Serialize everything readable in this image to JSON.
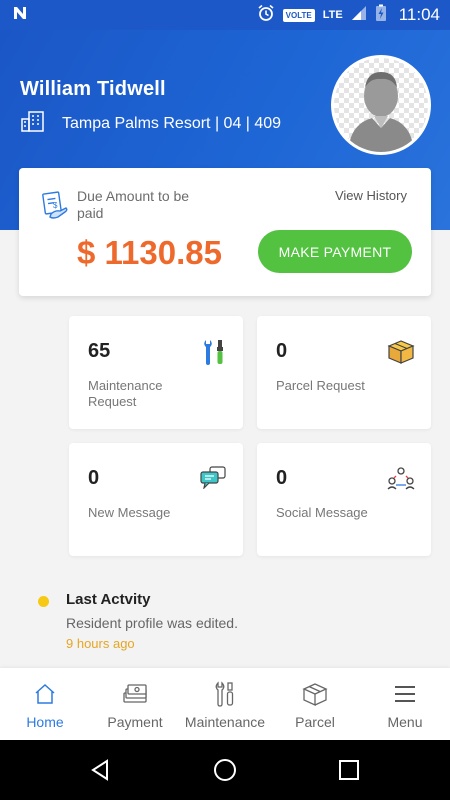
{
  "status_bar": {
    "volte": "VOLTE",
    "network": "LTE",
    "time": "11:04"
  },
  "header": {
    "name": "William Tidwell",
    "location": "Tampa Palms Resort | 04 | 409"
  },
  "due_card": {
    "label": "Due Amount to be paid",
    "view_history": "View History",
    "amount": "$ 1130.85",
    "pay_button": "MAKE PAYMENT"
  },
  "tiles": [
    {
      "count": "65",
      "label": "Maintenance Request",
      "icon": "tools-icon"
    },
    {
      "count": "0",
      "label": "Parcel Request",
      "icon": "parcel-box-icon"
    },
    {
      "count": "0",
      "label": "New Message",
      "icon": "chat-bubbles-icon"
    },
    {
      "count": "0",
      "label": "Social Message",
      "icon": "social-group-icon"
    }
  ],
  "activity": {
    "title": "Last Actvity",
    "text": "Resident profile was edited.",
    "time": "9 hours ago"
  },
  "nav": [
    {
      "label": "Home",
      "icon": "home-icon",
      "active": true
    },
    {
      "label": "Payment",
      "icon": "money-icon",
      "active": false
    },
    {
      "label": "Maintenance",
      "icon": "tools-icon",
      "active": false
    },
    {
      "label": "Parcel",
      "icon": "parcel-box-icon",
      "active": false
    },
    {
      "label": "Menu",
      "icon": "hamburger-menu-icon",
      "active": false
    }
  ],
  "colors": {
    "header_blue": "#1c58c8",
    "amount_orange": "#ee6a2c",
    "pay_green": "#53c241",
    "active_nav": "#2e7be0",
    "activity_dot": "#f6c915"
  }
}
